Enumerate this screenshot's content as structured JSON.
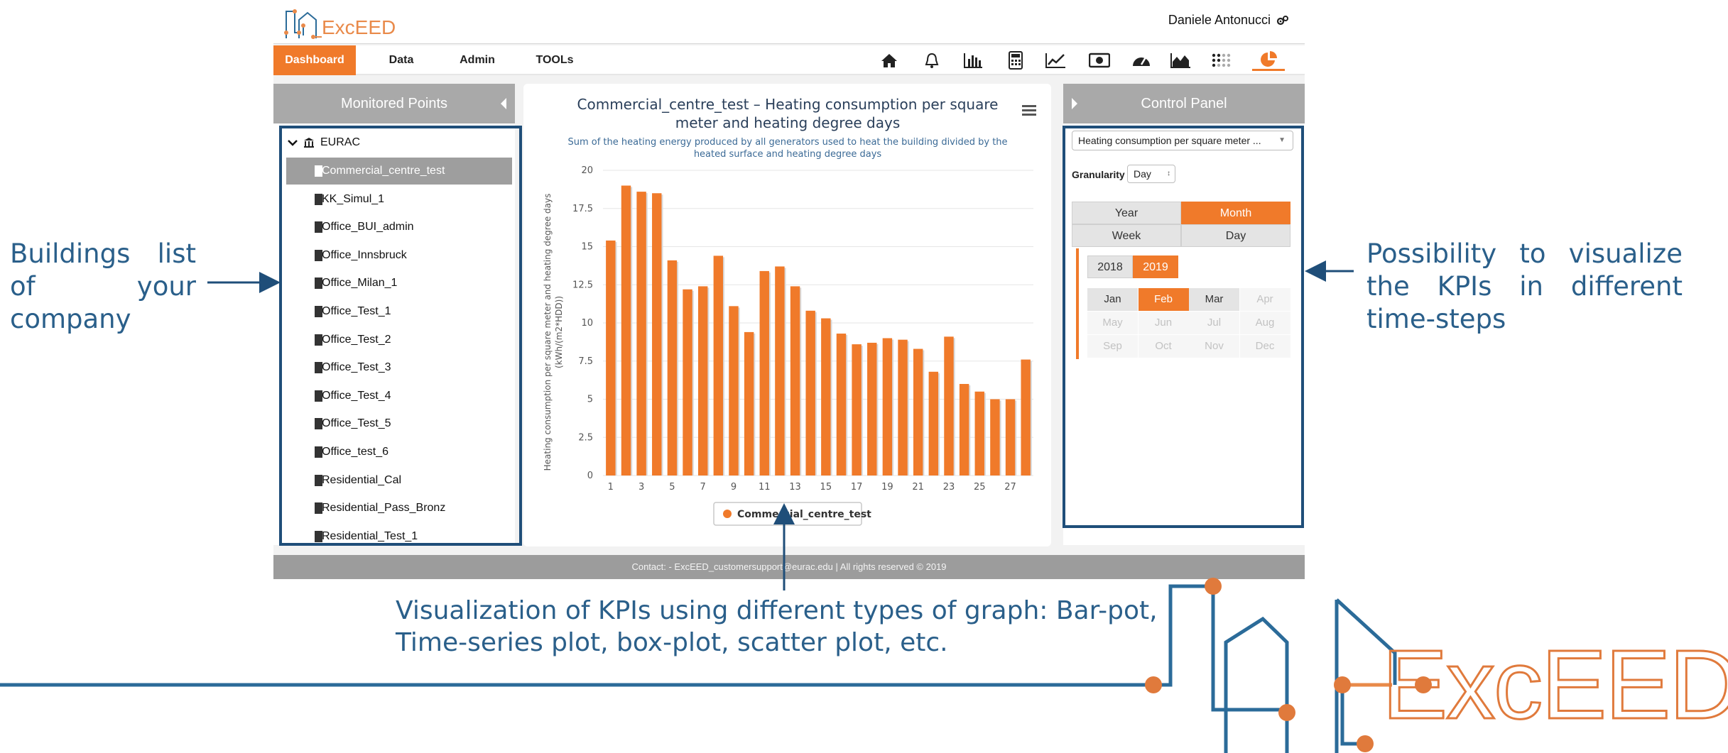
{
  "header": {
    "logo_text": "ExcEED",
    "user_name": "Daniele Antonucci",
    "user_icon": "gears-icon"
  },
  "nav": {
    "tabs": [
      {
        "label": "Dashboard",
        "active": true
      },
      {
        "label": "Data",
        "active": false
      },
      {
        "label": "Admin",
        "active": false
      },
      {
        "label": "TOOLs",
        "active": false
      }
    ],
    "icons": [
      "home-icon",
      "bell-icon",
      "bar-chart-icon",
      "calculator-icon",
      "line-chart-icon",
      "money-icon",
      "gauge-icon",
      "area-chart-icon",
      "dots-grid-icon",
      "pie-chart-icon"
    ],
    "active_icon": "pie-chart-icon",
    "accent_color": "#f07a2a"
  },
  "left_panel": {
    "title": "Monitored Points",
    "root": "EURAC",
    "items": [
      {
        "label": "Commercial_centre_test",
        "selected": true
      },
      {
        "label": "KK_Simul_1",
        "selected": false
      },
      {
        "label": "Office_BUI_admin",
        "selected": false
      },
      {
        "label": "Office_Innsbruck",
        "selected": false
      },
      {
        "label": "Office_Milan_1",
        "selected": false
      },
      {
        "label": "Office_Test_1",
        "selected": false
      },
      {
        "label": "Office_Test_2",
        "selected": false
      },
      {
        "label": "Office_Test_3",
        "selected": false
      },
      {
        "label": "Office_Test_4",
        "selected": false
      },
      {
        "label": "Office_Test_5",
        "selected": false
      },
      {
        "label": "Office_test_6",
        "selected": false
      },
      {
        "label": "Residential_Cal",
        "selected": false
      },
      {
        "label": "Residential_Pass_Bronz",
        "selected": false
      },
      {
        "label": "Residential_Test_1",
        "selected": false
      }
    ]
  },
  "chart_data": {
    "type": "bar",
    "title": "Commercial_centre_test – Heating consumption per square meter and heating degree days",
    "subtitle": "Sum of the heating energy produced by all generators used to heat the building divided by the heated surface and heating degree days",
    "xlabel": "",
    "ylabel": "Heating consumption per square meter and heating degree days (kWh/(m2*HDD))",
    "ylim": [
      0,
      20
    ],
    "yticks": [
      "0",
      "2.5",
      "5",
      "7.5",
      "10",
      "12.5",
      "15",
      "17.5",
      "20"
    ],
    "xticks": [
      "1",
      "3",
      "5",
      "7",
      "9",
      "11",
      "13",
      "15",
      "17",
      "19",
      "21",
      "23",
      "25",
      "27"
    ],
    "categories": [
      1,
      2,
      3,
      4,
      5,
      6,
      7,
      8,
      9,
      10,
      11,
      12,
      13,
      14,
      15,
      16,
      17,
      18,
      19,
      20,
      21,
      22,
      23,
      24,
      25,
      26,
      27,
      28
    ],
    "series": [
      {
        "name": "Commercial_centre_test",
        "color": "#f07a2a",
        "values": [
          15.4,
          19.0,
          18.6,
          18.5,
          14.1,
          12.2,
          12.4,
          14.4,
          11.1,
          9.4,
          13.4,
          13.7,
          12.4,
          10.8,
          10.3,
          9.3,
          8.6,
          8.7,
          9.0,
          8.9,
          8.3,
          6.8,
          9.1,
          6.0,
          5.5,
          5.0,
          5.0,
          7.6
        ]
      }
    ],
    "grid": true,
    "legend": "bottom-center",
    "menu_icon": "hamburger-menu-icon"
  },
  "control_panel": {
    "title": "Control Panel",
    "kpi_select": "Heating consumption per square meter ...",
    "granularity_label": "Granularity",
    "granularity_value": "Day",
    "period_buttons": [
      {
        "label": "Year",
        "active": false
      },
      {
        "label": "Month",
        "active": true
      },
      {
        "label": "Week",
        "active": false
      },
      {
        "label": "Day",
        "active": false
      }
    ],
    "years": [
      {
        "label": "2018",
        "active": false
      },
      {
        "label": "2019",
        "active": true
      }
    ],
    "months": [
      {
        "label": "Jan",
        "state": "enabled"
      },
      {
        "label": "Feb",
        "state": "active"
      },
      {
        "label": "Mar",
        "state": "enabled"
      },
      {
        "label": "Apr",
        "state": "disabled"
      },
      {
        "label": "May",
        "state": "disabled"
      },
      {
        "label": "Jun",
        "state": "disabled"
      },
      {
        "label": "Jul",
        "state": "disabled"
      },
      {
        "label": "Aug",
        "state": "disabled"
      },
      {
        "label": "Sep",
        "state": "disabled"
      },
      {
        "label": "Oct",
        "state": "disabled"
      },
      {
        "label": "Nov",
        "state": "disabled"
      },
      {
        "label": "Dec",
        "state": "disabled"
      }
    ]
  },
  "footer": {
    "text": "Contact: - ExcEED_customersupport@eurac.edu | All rights reserved © 2019"
  },
  "annotations": {
    "left": [
      "Buildings",
      "list",
      "of",
      "your",
      "company"
    ],
    "right": "Possibility to visualize the KPIs in different time-steps",
    "bottom_line1": "Visualization of KPIs using different types of graph: Bar-pot,",
    "bottom_line2": "Time-series plot, box-plot, scatter plot, etc.",
    "color": "#2a5f8a"
  },
  "brand_logo_text": "ExcEED"
}
